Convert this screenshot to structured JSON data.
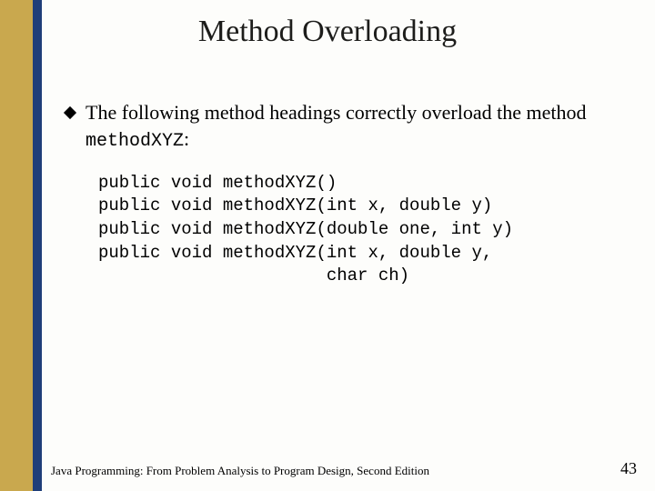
{
  "title": "Method Overloading",
  "bullet": {
    "prefix": "The following method headings correctly overload the method ",
    "method_name": "methodXYZ",
    "suffix": ":"
  },
  "code": "public void methodXYZ()\npublic void methodXYZ(int x, double y)\npublic void methodXYZ(double one, int y)\npublic void methodXYZ(int x, double y,\n                      char ch)",
  "footer": {
    "text": "Java Programming: From Problem Analysis to Program Design, Second Edition",
    "page": "43"
  }
}
